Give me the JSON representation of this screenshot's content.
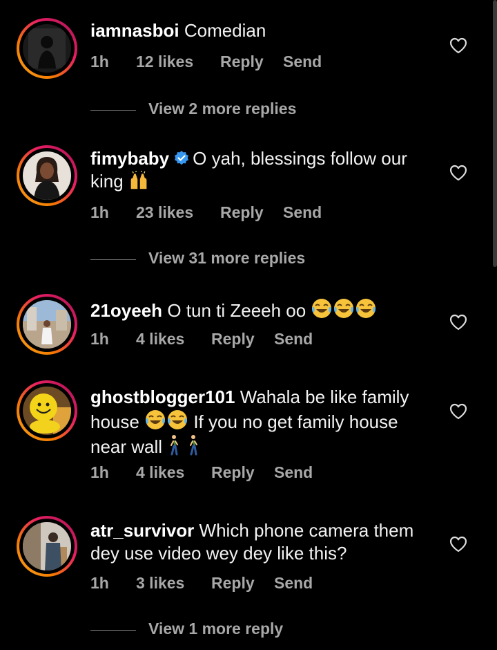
{
  "comments": [
    {
      "username": "iamnasboi",
      "text": "Comedian",
      "time": "1h",
      "likes": "12 likes",
      "reply": "Reply",
      "send": "Send",
      "view_replies": "View 2 more replies"
    },
    {
      "username": "fimybaby",
      "verified": true,
      "text": "O yah, blessings follow our king",
      "time": "1h",
      "likes": "23 likes",
      "reply": "Reply",
      "send": "Send",
      "view_replies": "View 31 more replies"
    },
    {
      "username": "21oyeeh",
      "text": "O tun ti Zeeeh oo",
      "time": "1h",
      "likes": "4 likes",
      "reply": "Reply",
      "send": "Send"
    },
    {
      "username": "ghostblogger101",
      "text_line1": "Wahala be like family",
      "text_line2a": "house",
      "text_line2b": "If you no get family house",
      "text_line3": "near wall",
      "time": "1h",
      "likes": "4 likes",
      "reply": "Reply",
      "send": "Send"
    },
    {
      "username": "atr_survivor",
      "text_line1": "Which phone camera them",
      "text_line2": "dey use video wey dey like this?",
      "time": "1h",
      "likes": "3 likes",
      "reply": "Reply",
      "send": "Send",
      "view_replies": "View 1 more reply"
    }
  ],
  "icons": {
    "heart": "heart-icon",
    "verified": "verified-badge-icon",
    "emoji_laugh": "tears-of-joy-emoji",
    "emoji_praise": "raising-hands-emoji",
    "emoji_walk": "person-walking-emoji"
  },
  "colors": {
    "background": "#000000",
    "text": "#f2f2f2",
    "meta": "#a8a8a8",
    "verified": "#3897f0",
    "story_ring_start": "#f9a825",
    "story_ring_end": "#c2185b"
  }
}
